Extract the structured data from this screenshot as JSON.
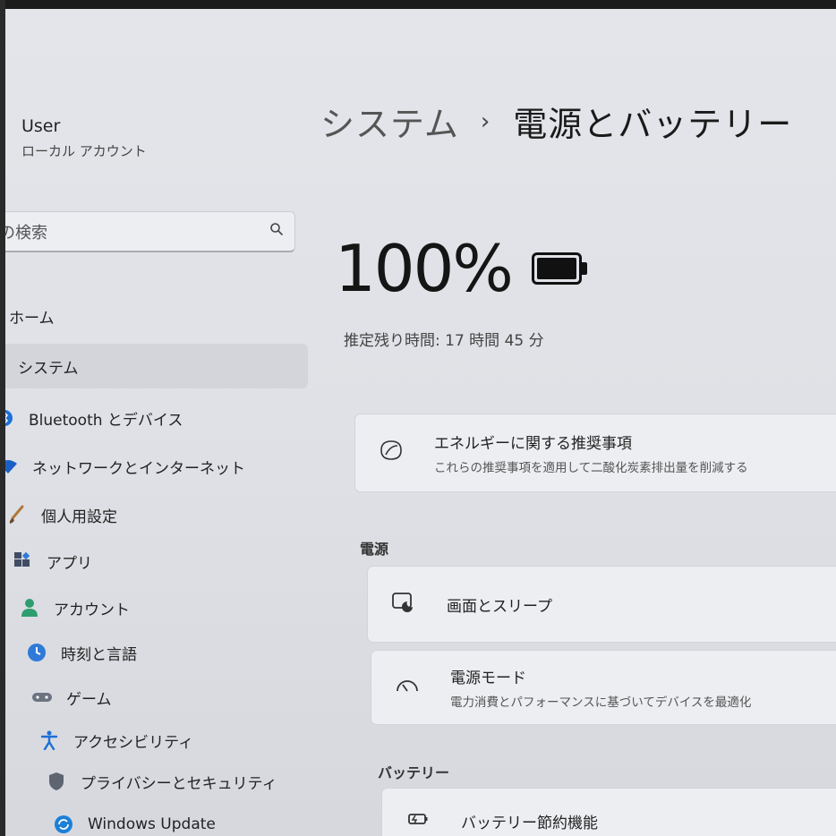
{
  "user": {
    "name": "User",
    "account_type": "ローカル アカウント"
  },
  "search": {
    "text": "の検索"
  },
  "nav": [
    {
      "label": "ホーム",
      "icon": "home-icon"
    },
    {
      "label": "システム",
      "icon": "system-icon",
      "active": true
    },
    {
      "label": "Bluetooth とデバイス",
      "icon": "bluetooth-icon"
    },
    {
      "label": "ネットワークとインターネット",
      "icon": "wifi-icon"
    },
    {
      "label": "個人用設定",
      "icon": "brush-icon"
    },
    {
      "label": "アプリ",
      "icon": "apps-icon"
    },
    {
      "label": "アカウント",
      "icon": "account-icon"
    },
    {
      "label": "時刻と言語",
      "icon": "time-language-icon"
    },
    {
      "label": "ゲーム",
      "icon": "gamepad-icon"
    },
    {
      "label": "アクセシビリティ",
      "icon": "accessibility-icon"
    },
    {
      "label": "プライバシーとセキュリティ",
      "icon": "shield-icon"
    },
    {
      "label": "Windows Update",
      "icon": "windows-update-icon"
    }
  ],
  "header": {
    "parent": "システム",
    "separator": "›",
    "current": "電源とバッテリー"
  },
  "battery": {
    "percent": "100%",
    "level": 1.0,
    "remaining": "推定残り時間: 17 時間 45 分"
  },
  "energy_card": {
    "title": "エネルギーに関する推奨事項",
    "desc": "これらの推奨事項を適用して二酸化炭素排出量を削減する",
    "icon": "leaf-icon"
  },
  "power_section": "電源",
  "screen_sleep": {
    "title": "画面とスリープ",
    "icon": "screen-sleep-icon"
  },
  "power_mode": {
    "title": "電源モード",
    "desc": "電力消費とパフォーマンスに基づいてデバイスを最適化",
    "icon": "gauge-icon"
  },
  "battery_section": "バッテリー",
  "battery_saver": {
    "title": "バッテリー節約機能",
    "icon": "battery-saver-icon"
  },
  "colors": {
    "accent": "#1a5fb4",
    "bluetooth": "#1e6fd6",
    "account": "#2e9e6e",
    "update": "#1c7fd8"
  }
}
